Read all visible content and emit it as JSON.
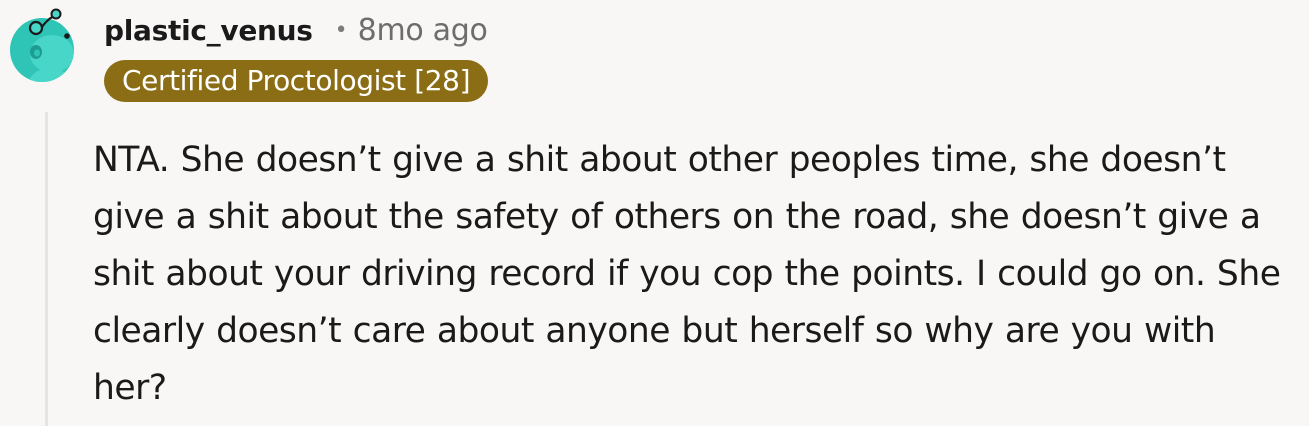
{
  "comment": {
    "username": "plastic_venus",
    "separator": "•",
    "timestamp": "8mo ago",
    "flair": "Certified Proctologist [28]",
    "body": "NTA. She doesn’t give a shit about other peoples time, she doesn’t give a shit about the safety of others on the road, she doesn’t give a shit about your driving record if you cop the points. I could go on. She clearly doesn’t care about anyone but herself so why are you with her?",
    "avatar_icon": "snoo-avatar-icon",
    "colors": {
      "avatar_bg": "#2ec4b6",
      "flair_bg": "#8a6d14",
      "flair_text": "#ffffff",
      "text": "#1a1a1b",
      "meta": "#6d6d6d",
      "thread_line": "#e6e4e1",
      "page_bg": "#f9f7f5"
    }
  }
}
